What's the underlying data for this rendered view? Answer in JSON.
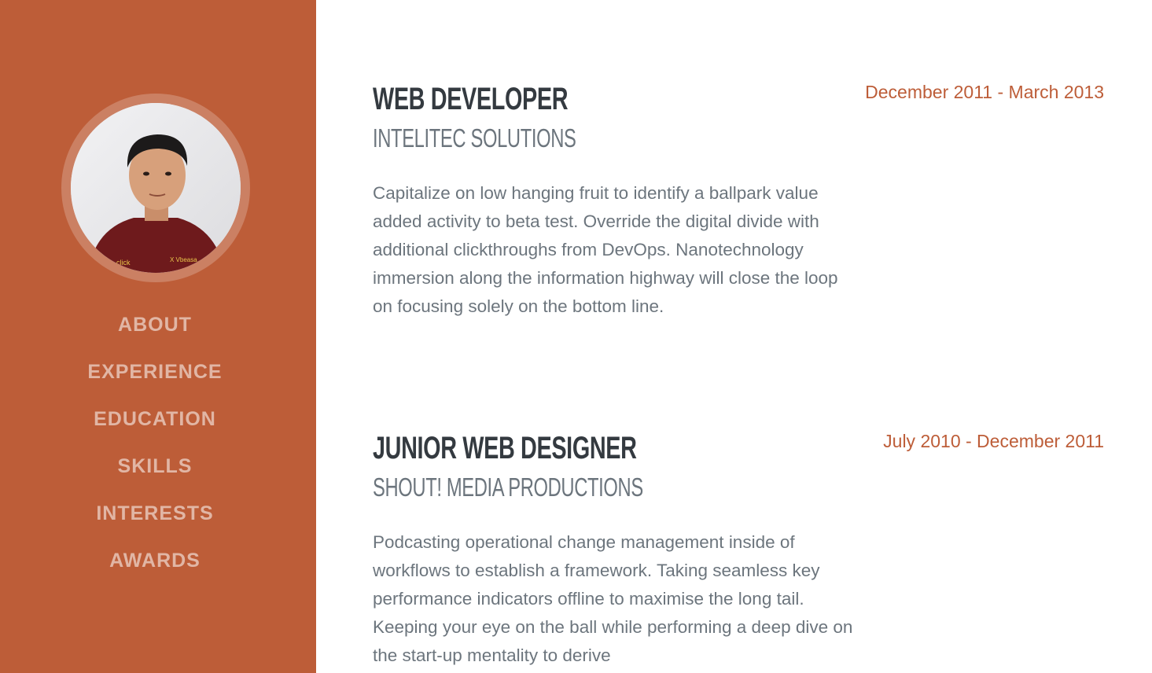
{
  "nav": {
    "items": [
      {
        "label": "ABOUT"
      },
      {
        "label": "EXPERIENCE"
      },
      {
        "label": "EDUCATION"
      },
      {
        "label": "SKILLS"
      },
      {
        "label": "INTERESTS"
      },
      {
        "label": "AWARDS"
      }
    ]
  },
  "colors": {
    "sidebar": "#bd5d38",
    "accent": "#bd5d38",
    "heading": "#343a40",
    "muted": "#6c757d"
  },
  "experience": [
    {
      "title": "WEB DEVELOPER",
      "company": "INTELITEC SOLUTIONS",
      "date": "December 2011 - March 2013",
      "description": "Capitalize on low hanging fruit to identify a ballpark value added activity to beta test. Override the digital divide with additional clickthroughs from DevOps. Nanotechnology immersion along the information highway will close the loop on focusing solely on the bottom line."
    },
    {
      "title": "JUNIOR WEB DESIGNER",
      "company": "SHOUT! MEDIA PRODUCTIONS",
      "date": "July 2010 - December 2011",
      "description": "Podcasting operational change management inside of workflows to establish a framework. Taking seamless key performance indicators offline to maximise the long tail. Keeping your eye on the ball while performing a deep dive on the start-up mentality to derive"
    }
  ]
}
